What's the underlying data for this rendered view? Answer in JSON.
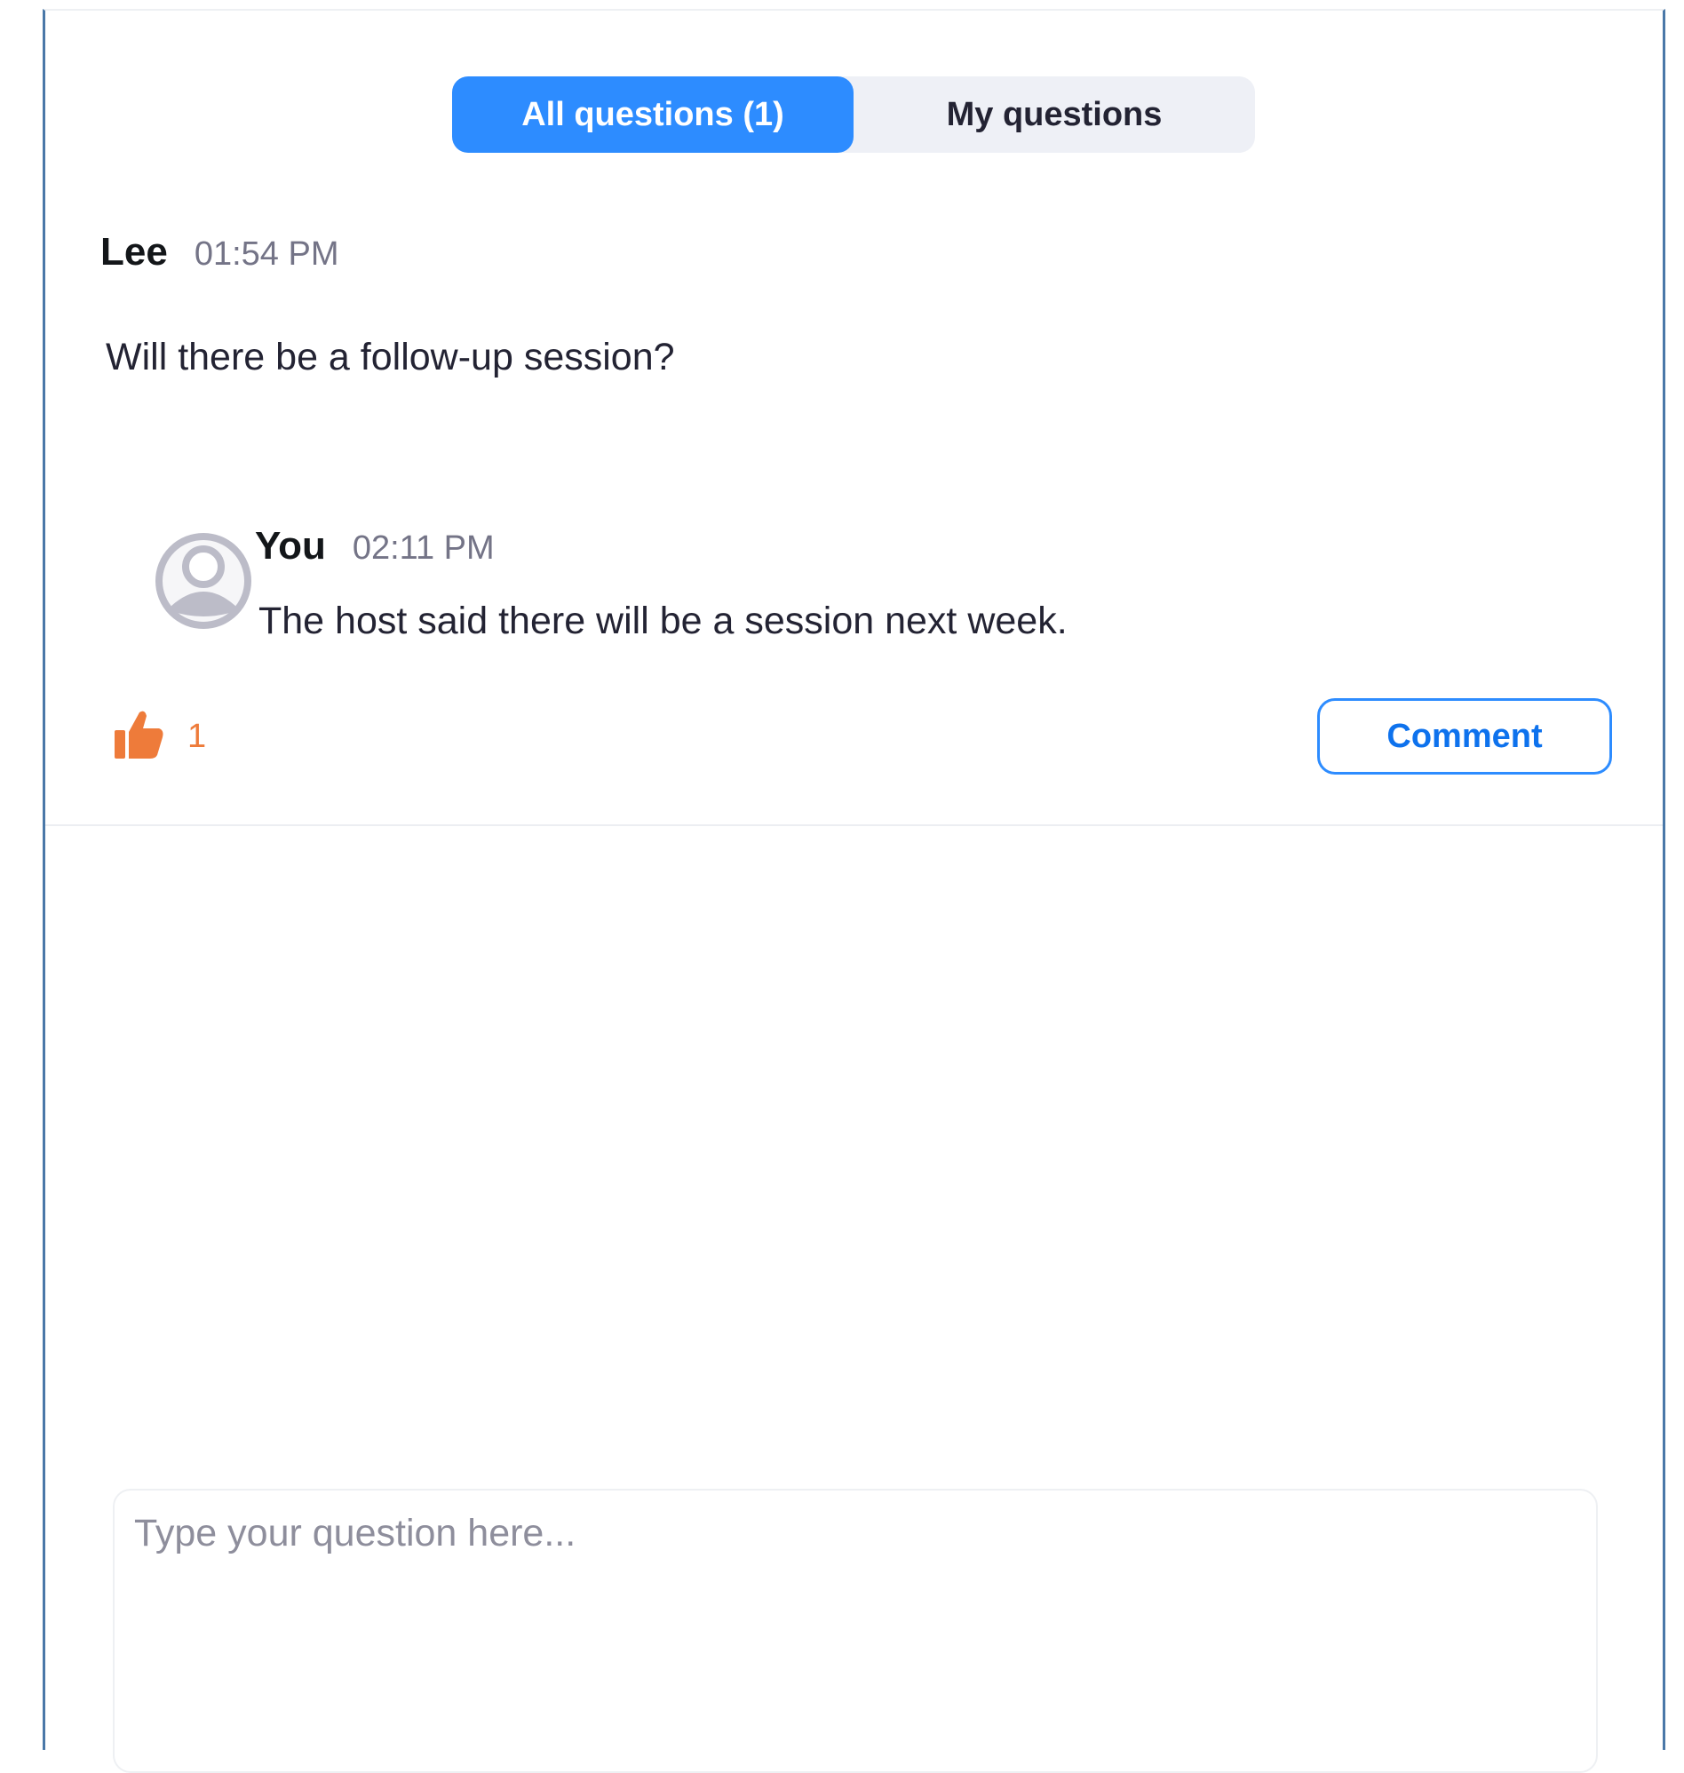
{
  "tabs": [
    {
      "label": "All questions  (1)",
      "active": true
    },
    {
      "label": "My questions",
      "active": false
    }
  ],
  "question": {
    "author": "Lee",
    "time": "01:54 PM",
    "text": "Will there be a follow-up session?",
    "upvotes": "1"
  },
  "reply": {
    "author": "You",
    "time": "02:11 PM",
    "text": "The host said there will be a session next week."
  },
  "actions": {
    "comment_label": "Comment"
  },
  "input": {
    "placeholder": "Type your question here...",
    "value": ""
  },
  "icons": {
    "upvote": "thumbs-up-icon",
    "avatar": "user-avatar-icon"
  },
  "colors": {
    "accent": "#2d8cff",
    "upvote": "#ee7b3a",
    "avatar": "#bcbcc8"
  }
}
